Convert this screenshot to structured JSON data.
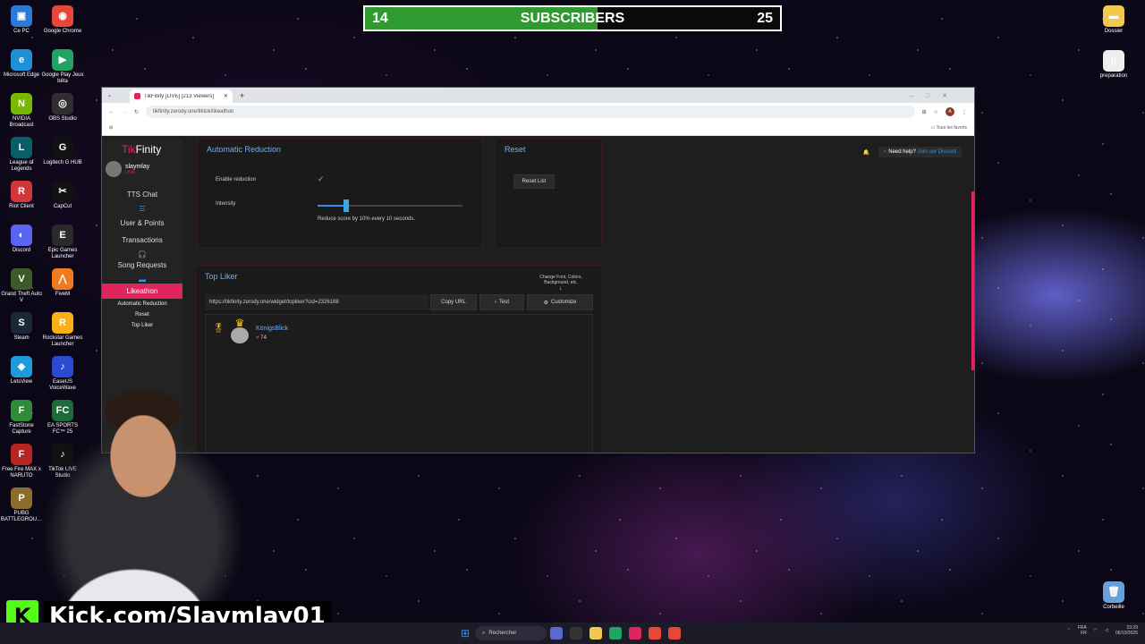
{
  "desktop": {
    "left_icons": [
      {
        "label": "Ce PC",
        "color": "#2b7bd6",
        "glyph": "▣",
        "icon": "computer-icon"
      },
      {
        "label": "Google Chrome",
        "color": "#e9463a",
        "glyph": "◉",
        "icon": "chrome-icon"
      },
      {
        "label": "Microsoft Edge",
        "color": "#1f8fd6",
        "glyph": "e",
        "icon": "edge-icon"
      },
      {
        "label": "Google Play Jeux bêta",
        "color": "#1fa463",
        "glyph": "▶",
        "icon": "play-games-icon"
      },
      {
        "label": "NVIDIA Broadcast",
        "color": "#76b900",
        "glyph": "N",
        "icon": "nvidia-icon"
      },
      {
        "label": "OBS Studio",
        "color": "#302e31",
        "glyph": "◎",
        "icon": "obs-icon"
      },
      {
        "label": "League of Legends",
        "color": "#0a5e68",
        "glyph": "L",
        "icon": "league-icon"
      },
      {
        "label": "Logitech G HUB",
        "color": "#111111",
        "glyph": "G",
        "icon": "logitech-icon"
      },
      {
        "label": "Riot Client",
        "color": "#d13639",
        "glyph": "R",
        "icon": "riot-icon"
      },
      {
        "label": "CapCut",
        "color": "#111111",
        "glyph": "✂",
        "icon": "capcut-icon"
      },
      {
        "label": "Discord",
        "color": "#5865f2",
        "glyph": "◐",
        "icon": "discord-icon"
      },
      {
        "label": "Epic Games Launcher",
        "color": "#2a2a2a",
        "glyph": "E",
        "icon": "epic-icon"
      },
      {
        "label": "Grand Theft Auto V",
        "color": "#3d5a2a",
        "glyph": "V",
        "icon": "gta-icon"
      },
      {
        "label": "FiveM",
        "color": "#f07b1e",
        "glyph": "⋀",
        "icon": "fivem-icon"
      },
      {
        "label": "Steam",
        "color": "#1b2838",
        "glyph": "S",
        "icon": "steam-icon"
      },
      {
        "label": "Rockstar Games Launcher",
        "color": "#fcaf17",
        "glyph": "R",
        "icon": "rockstar-icon"
      },
      {
        "label": "LetsView",
        "color": "#1e9bd7",
        "glyph": "◈",
        "icon": "letsview-icon"
      },
      {
        "label": "EaseUS VoiceWave",
        "color": "#2a4ad0",
        "glyph": "♪",
        "icon": "voicewave-icon"
      },
      {
        "label": "FastStone Capture",
        "color": "#2e8b3a",
        "glyph": "F",
        "icon": "faststone-icon"
      },
      {
        "label": "EA SPORTS FC™ 25",
        "color": "#1d6b3a",
        "glyph": "FC",
        "icon": "easports-icon"
      },
      {
        "label": "Free Fire MAX x NARUTO",
        "color": "#b62424",
        "glyph": "F",
        "icon": "freefire-icon"
      },
      {
        "label": "TikTok LIVE Studio",
        "color": "#111111",
        "glyph": "♪",
        "icon": "tiktok-icon"
      },
      {
        "label": "PUBG BATTLEGROU…",
        "color": "#8a6d2a",
        "glyph": "P",
        "icon": "pubg-icon"
      }
    ],
    "right_icons": [
      {
        "label": "Dossier",
        "color": "#f2c94c",
        "glyph": "▬",
        "icon": "folder-icon"
      },
      {
        "label": "preparation",
        "color": "#eeeeee",
        "glyph": "▯",
        "icon": "file-icon"
      },
      {
        "label": "Corbeille",
        "color": "#6aa0d8",
        "glyph": "🗑",
        "icon": "recycle-bin-icon"
      }
    ]
  },
  "subscribers": {
    "current": "14",
    "label": "SUBSCRIBERS",
    "goal": "25",
    "progress": 0.56,
    "fill": "#2f9a2f"
  },
  "browser": {
    "tab_title": "TikFinity [LIVE] [213 Viewers]",
    "url": "tikfinity.zerody.one/tiktok/likeathon",
    "bookmarks_label": "Tous les favoris",
    "profile_initial": "A"
  },
  "app": {
    "logo_prefix": "Tik",
    "logo_suffix": "Finity",
    "user": {
      "name": "slaymlay",
      "status": "LIVE"
    },
    "nav": [
      "TTS Chat",
      "User & Points",
      "Transactions",
      "Song Requests"
    ],
    "active": "Likeathon",
    "sub_nav": [
      "Automatic Reduction",
      "Reset",
      "Top Liker"
    ],
    "auto_reduction": {
      "title": "Automatic Reduction",
      "enable_label": "Enable reduction",
      "intensity_label": "Intensity",
      "intensity_value": 0.2,
      "note": "Reduce score by 10% every 10 seconds."
    },
    "reset": {
      "title": "Reset",
      "button": "Reset List"
    },
    "top_liker": {
      "title": "Top Liker",
      "hint": "Change Font, Colors, Background, etc.",
      "widget_url": "https://tikfinity.zerody.one/widget/topliker?cid=2326188",
      "copy_label": "Copy URL",
      "test_label": "Test",
      "customize_label": "Customize",
      "liker_name": "KönigsBlick",
      "liker_count": "74"
    },
    "help": {
      "text": "Need help?",
      "link": "Join our Discord"
    }
  },
  "overlay": {
    "kick_text": "Kick.com/Slaymlay01"
  },
  "taskbar": {
    "search_placeholder": "Rechercher",
    "lang": "FRA",
    "region": "FR",
    "time": "23:29",
    "date": "06/10/2025"
  }
}
